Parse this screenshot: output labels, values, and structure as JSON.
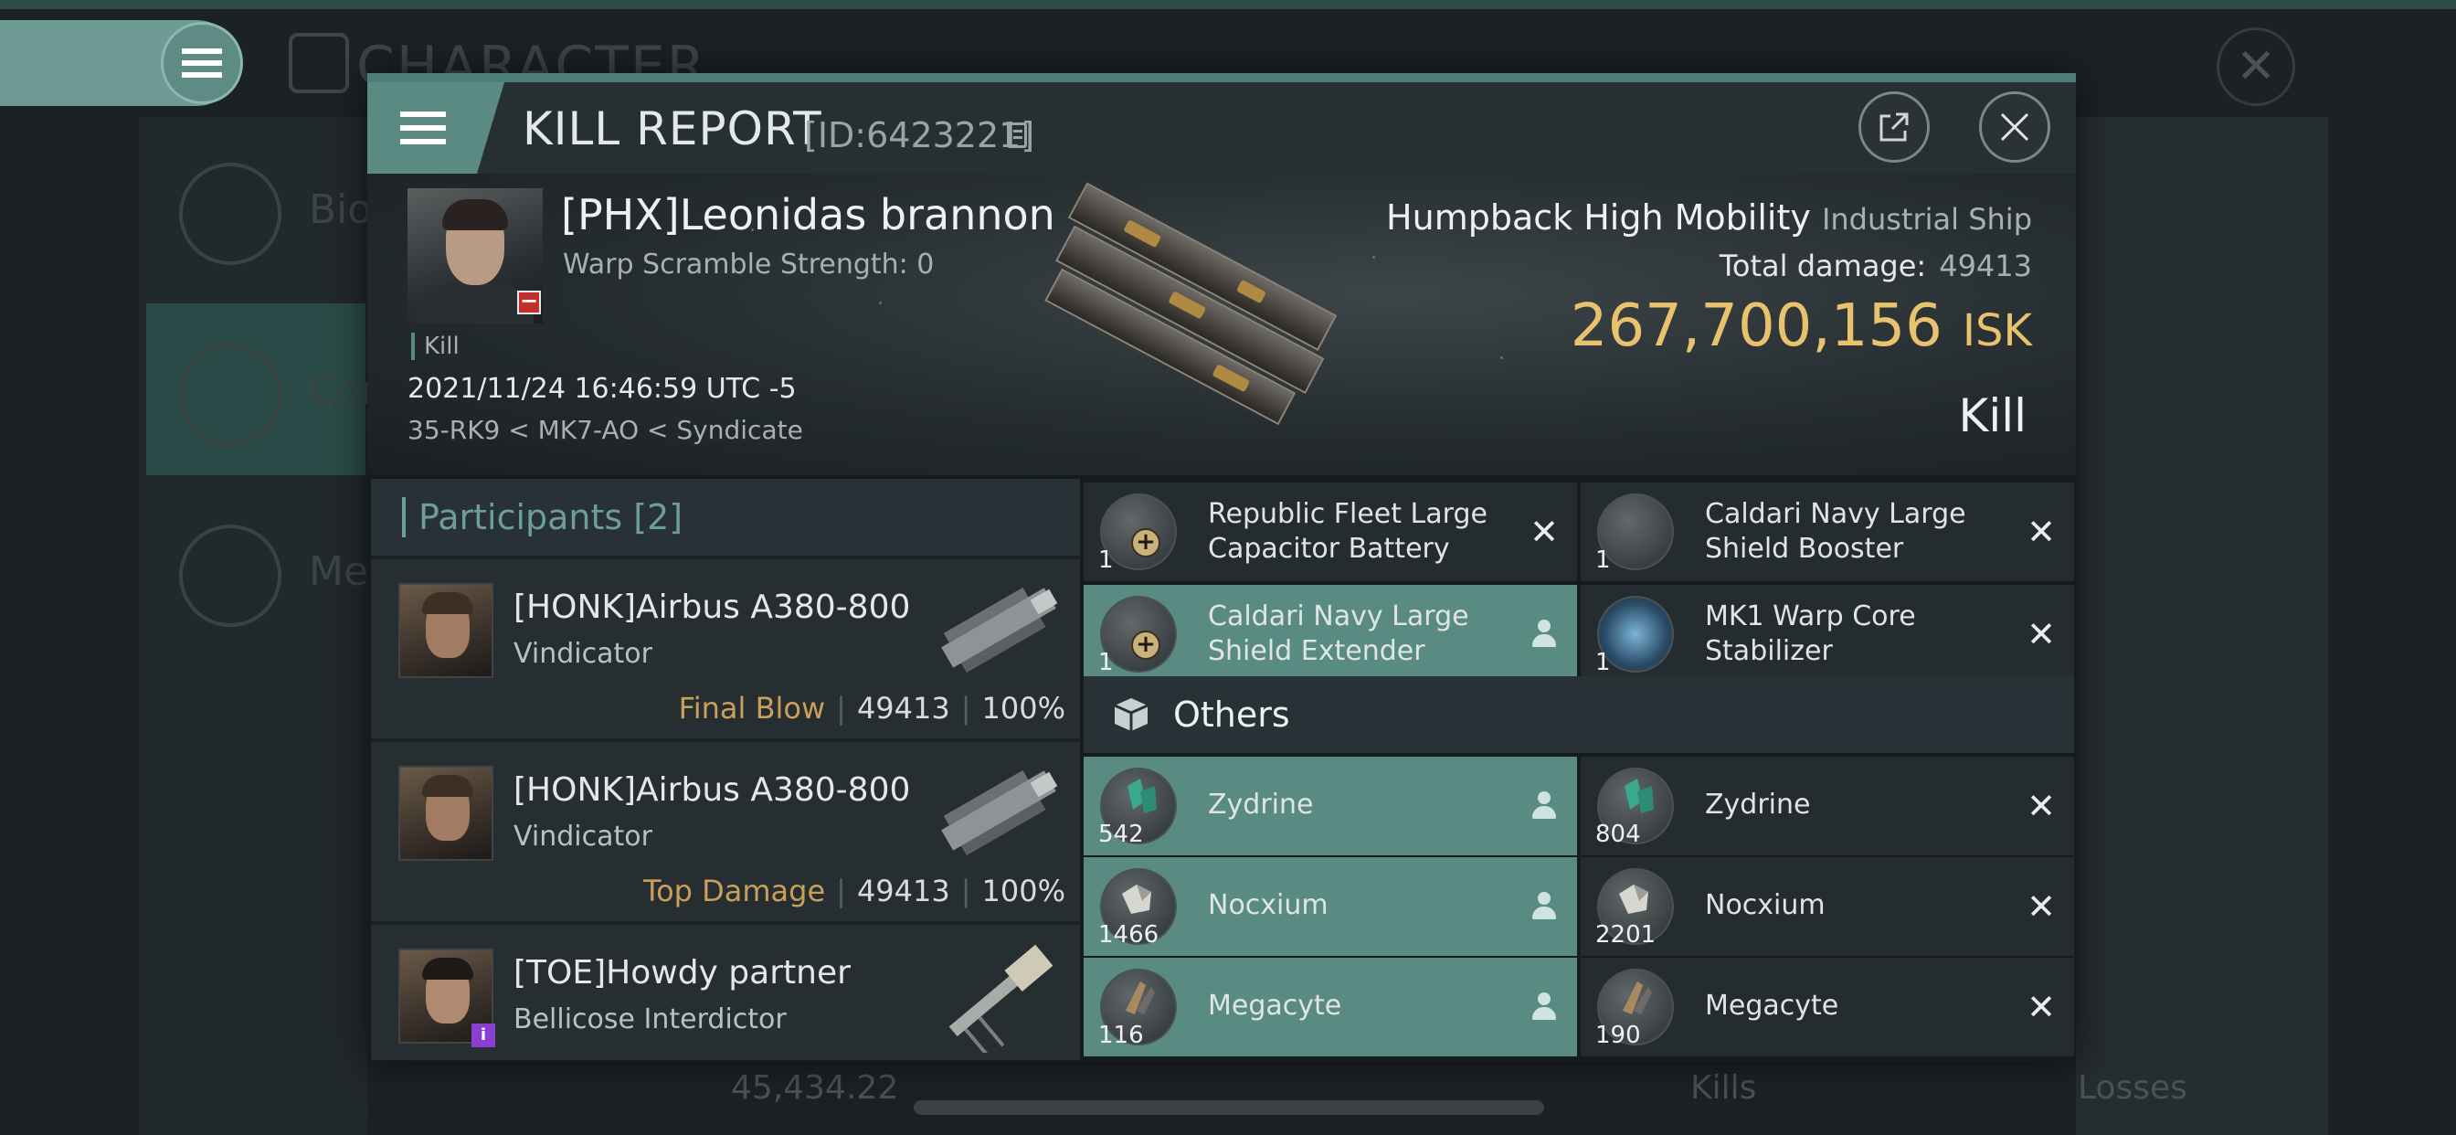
{
  "background": {
    "title": "CHARACTER",
    "nav": [
      {
        "label": "Bio"
      },
      {
        "label": "Com"
      },
      {
        "label": "Med"
      }
    ],
    "bottom": {
      "value": "45,434.22",
      "kills_label": "Kills",
      "losses_label": "Losses"
    }
  },
  "modal": {
    "title": "KILL REPORT",
    "id": "[ID:6423221]"
  },
  "victim": {
    "name": "[PHX]Leonidas brannon",
    "warp_scramble": "Warp Scramble Strength: 0",
    "tag": "Kill",
    "datetime": "2021/11/24 16:46:59 UTC -5",
    "location": "35-RK9 < MK7-AO < Syndicate",
    "ship_name": "Humpback High Mobility",
    "ship_class": "Industrial Ship",
    "total_damage_label": "Total damage:",
    "total_damage": "49413",
    "isk_value": "267,700,156",
    "isk_unit": "ISK",
    "result": "Kill"
  },
  "participants": {
    "header": "Participants [2]",
    "rows": [
      {
        "name": "[HONK]Airbus A380-800",
        "ship": "Vindicator",
        "label": "Final Blow",
        "damage": "49413",
        "pct": "100%"
      },
      {
        "name": "[HONK]Airbus A380-800",
        "ship": "Vindicator",
        "label": "Top Damage",
        "damage": "49413",
        "pct": "100%"
      },
      {
        "name": "[TOE]Howdy partner",
        "ship": "Bellicose Interdictor"
      }
    ]
  },
  "fitted_items": [
    {
      "qty": "1",
      "name_line1": "Republic Fleet Large",
      "name_line2": "Capacitor Battery",
      "status": "destroyed"
    },
    {
      "qty": "1",
      "name_line1": "Caldari Navy Large",
      "name_line2": "Shield Booster",
      "status": "destroyed"
    },
    {
      "qty": "1",
      "name_line1": "Caldari Navy Large",
      "name_line2": "Shield Extender",
      "status": "dropped"
    },
    {
      "qty": "1",
      "name_line1": "MK1 Warp Core",
      "name_line2": "Stabilizer",
      "status": "destroyed"
    }
  ],
  "others": {
    "header": "Others",
    "items": [
      {
        "qty": "542",
        "name": "Zydrine",
        "status": "dropped"
      },
      {
        "qty": "804",
        "name": "Zydrine",
        "status": "destroyed"
      },
      {
        "qty": "1466",
        "name": "Nocxium",
        "status": "dropped"
      },
      {
        "qty": "2201",
        "name": "Nocxium",
        "status": "destroyed"
      },
      {
        "qty": "116",
        "name": "Megacyte",
        "status": "dropped"
      },
      {
        "qty": "190",
        "name": "Megacyte",
        "status": "destroyed"
      }
    ]
  },
  "colors": {
    "accent": "#5b8a83",
    "isk": "#e8c26c",
    "final_blow": "#c9a05a"
  }
}
